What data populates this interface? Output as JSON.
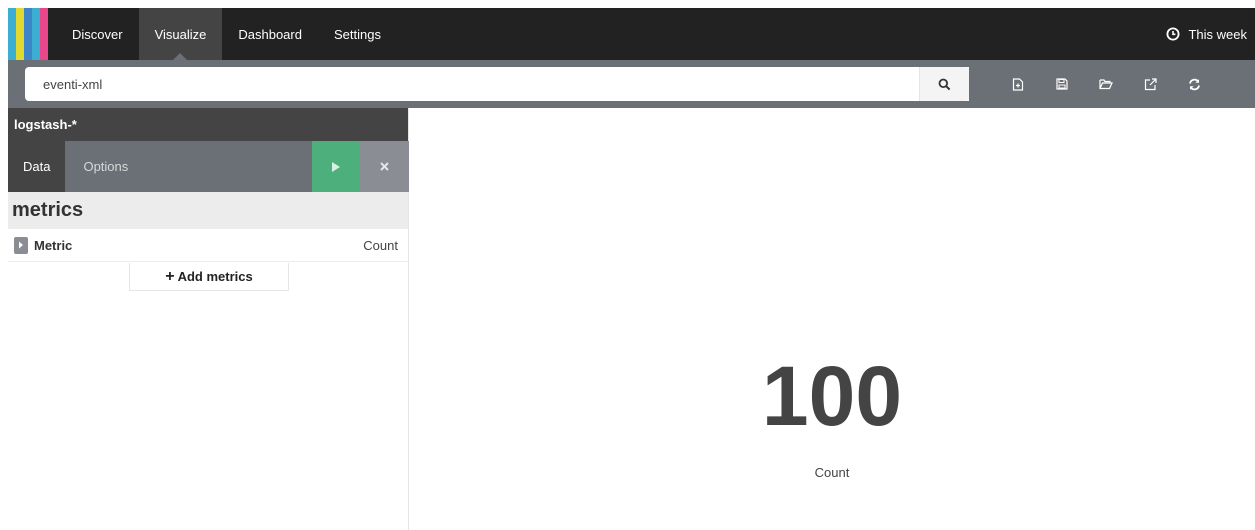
{
  "logo": {
    "stripe_colors": [
      "#3caed2",
      "#e1d830",
      "#3c85c6",
      "#3caed2",
      "#e8478b"
    ]
  },
  "nav": {
    "items": [
      {
        "label": "Discover",
        "active": false
      },
      {
        "label": "Visualize",
        "active": true
      },
      {
        "label": "Dashboard",
        "active": false
      },
      {
        "label": "Settings",
        "active": false
      }
    ],
    "timepicker": {
      "label": "This week",
      "icon": "clock-icon"
    }
  },
  "search": {
    "value": "eventi-xml",
    "button_icon": "search-icon"
  },
  "toolbar": {
    "icons": [
      "new-visualization-icon",
      "save-icon",
      "open-folder-icon",
      "share-icon",
      "refresh-icon"
    ]
  },
  "sidebar": {
    "index_pattern": "logstash-*",
    "tabs": [
      {
        "label": "Data",
        "active": true
      },
      {
        "label": "Options",
        "active": false
      }
    ],
    "apply_icon": "play-icon",
    "discard_icon": "close-icon",
    "section_title": "metrics",
    "aggregations": [
      {
        "label": "Metric",
        "description": "Count"
      }
    ],
    "add_button_label": "Add metrics"
  },
  "visualization": {
    "value": "100",
    "label": "Count"
  },
  "colors": {
    "nav_bg": "#222222",
    "nav_active": "#444444",
    "toolbar_bg": "#6b6f76",
    "apply_green": "#4daf7c",
    "discard_gray": "#8a8e94"
  }
}
